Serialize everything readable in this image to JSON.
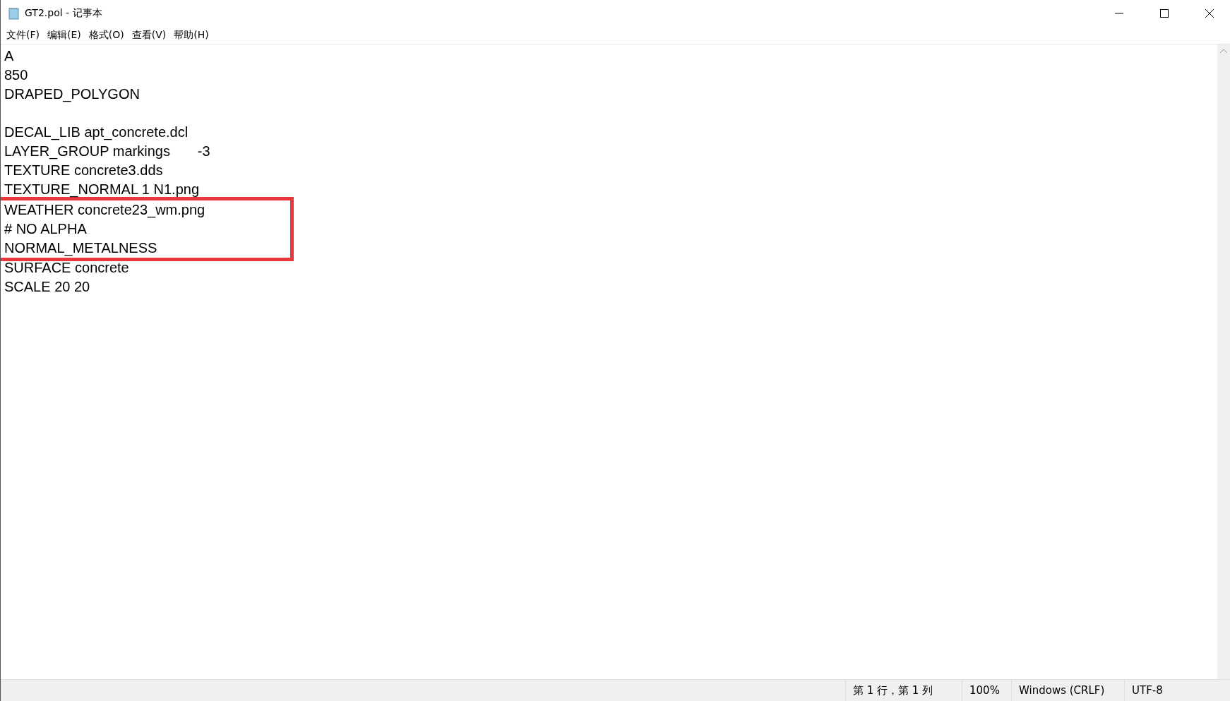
{
  "window": {
    "title": "GT2.pol - 记事本"
  },
  "menu": [
    {
      "label": "文件(F)"
    },
    {
      "label": "编辑(E)"
    },
    {
      "label": "格式(O)"
    },
    {
      "label": "查看(V)"
    },
    {
      "label": "帮助(H)"
    }
  ],
  "editor": {
    "lines": [
      {
        "kind": "text",
        "text": "A",
        "boxed": false
      },
      {
        "kind": "text",
        "text": "850",
        "boxed": false
      },
      {
        "kind": "text",
        "text": "DRAPED_POLYGON",
        "boxed": false
      },
      {
        "kind": "blank",
        "boxed": false
      },
      {
        "kind": "text",
        "text": "DECAL_LIB apt_concrete.dcl",
        "boxed": false
      },
      {
        "kind": "text",
        "text": "LAYER_GROUP markings       -3",
        "boxed": false
      },
      {
        "kind": "text",
        "text": "TEXTURE concrete3.dds",
        "boxed": false
      },
      {
        "kind": "text",
        "text": "TEXTURE_NORMAL 1 N1.png",
        "boxed": false
      },
      {
        "kind": "text",
        "text": "WEATHER concrete23_wm.png",
        "boxed": true
      },
      {
        "kind": "text",
        "text": "# NO ALPHA",
        "boxed": true
      },
      {
        "kind": "text",
        "text": "NORMAL_METALNESS",
        "boxed": true
      },
      {
        "kind": "text",
        "text": "SURFACE concrete",
        "boxed": false
      },
      {
        "kind": "text",
        "text": "SCALE 20 20",
        "boxed": false
      }
    ]
  },
  "status_bar": [
    "第 1 行，第 1 列",
    "100%",
    "Windows (CRLF)",
    "UTF-8"
  ]
}
